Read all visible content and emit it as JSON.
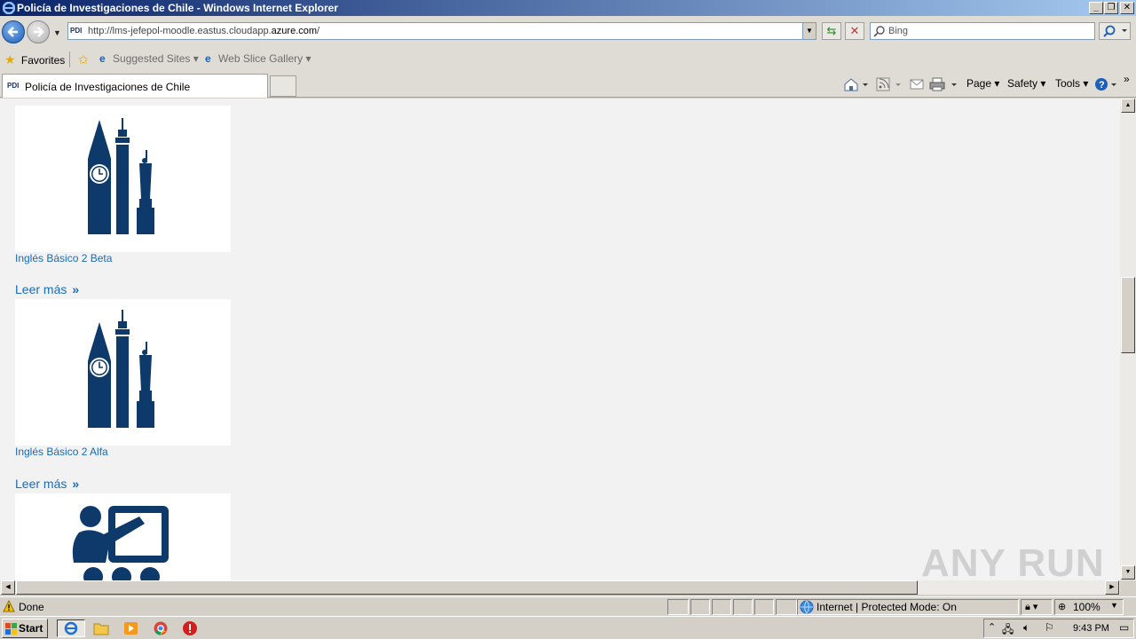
{
  "window": {
    "title": "Policía de Investigaciones de Chile - Windows Internet Explorer"
  },
  "address": {
    "url_prefix": "http://lms-jefepol-moodle.eastus.cloudapp.",
    "url_domain": "azure.com",
    "url_suffix": "/",
    "search_placeholder": "Bing",
    "site_badge": "PDI"
  },
  "favorites": {
    "label": "Favorites",
    "suggested": "Suggested Sites",
    "gallery": "Web Slice Gallery"
  },
  "tab": {
    "title": "Policía de Investigaciones de Chile"
  },
  "commands": {
    "page": "Page",
    "safety": "Safety",
    "tools": "Tools"
  },
  "content": {
    "courses": [
      {
        "name": "Inglés Básico 2 Beta",
        "read_more": "Leer más",
        "icon": "landmarks-icon"
      },
      {
        "name": "Inglés Básico 2 Alfa",
        "read_more": "Leer más",
        "icon": "landmarks-icon"
      },
      {
        "icon": "teacher-board-icon"
      }
    ],
    "chevron": "»"
  },
  "status": {
    "text": "Done",
    "zone": "Internet | Protected Mode: On",
    "zoom": "100%"
  },
  "taskbar": {
    "start": "Start",
    "clock": "9:43 PM"
  },
  "watermark": "ANY RUN",
  "colors": {
    "link": "#1a6bb8",
    "icon_navy": "#0d3a6a",
    "content_bg": "#f2f2f2"
  }
}
